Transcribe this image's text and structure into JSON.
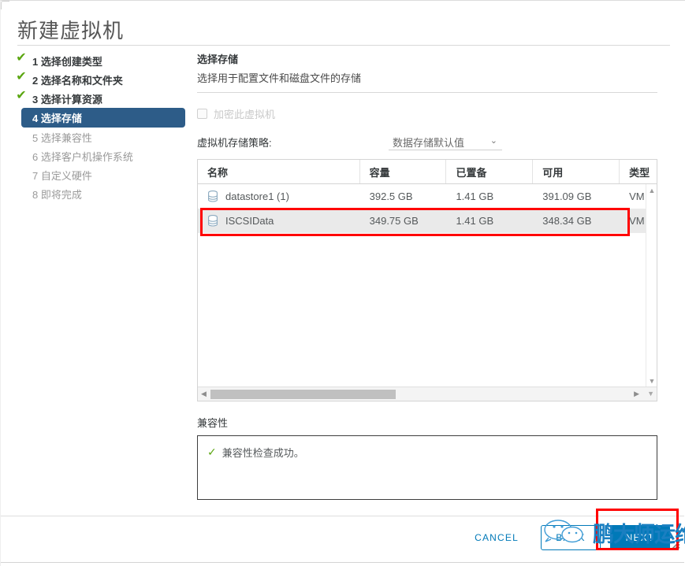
{
  "window": {
    "title": "新建虚拟机"
  },
  "steps": {
    "items": [
      {
        "num": "1",
        "label": "1 选择创建类型",
        "state": "done",
        "check": "✔"
      },
      {
        "num": "2",
        "label": "2 选择名称和文件夹",
        "state": "done",
        "check": "✔"
      },
      {
        "num": "3",
        "label": "3 选择计算资源",
        "state": "done",
        "check": "✔"
      },
      {
        "num": "4",
        "label": "4 选择存储",
        "state": "active",
        "check": ""
      },
      {
        "num": "5",
        "label": "5 选择兼容性",
        "state": "pending",
        "check": ""
      },
      {
        "num": "6",
        "label": "6 选择客户机操作系统",
        "state": "pending",
        "check": ""
      },
      {
        "num": "7",
        "label": "7 自定义硬件",
        "state": "pending",
        "check": ""
      },
      {
        "num": "8",
        "label": "8 即将完成",
        "state": "pending",
        "check": ""
      }
    ]
  },
  "content": {
    "section_title": "选择存储",
    "section_subtitle": "选择用于配置文件和磁盘文件的存储",
    "encrypt": {
      "label": "加密此虚拟机",
      "checked": false,
      "disabled": true
    },
    "policy": {
      "label": "虚拟机存储策略:",
      "value": "数据存储默认值",
      "caret": "⌄"
    },
    "table": {
      "columns": [
        "名称",
        "容量",
        "已置备",
        "可用",
        "类型"
      ],
      "rows": [
        {
          "name": "datastore1 (1)",
          "capacity": "392.5 GB",
          "provisioned": "1.41 GB",
          "free": "391.09 GB",
          "type": "VM",
          "selected": false,
          "icon": "datastore-icon"
        },
        {
          "name": "ISCSIData",
          "capacity": "349.75 GB",
          "provisioned": "1.41 GB",
          "free": "348.34 GB",
          "type": "VM",
          "selected": true,
          "icon": "datastore-icon"
        }
      ],
      "scroll_up_arrow": "▲",
      "scroll_down_arrow": "▼",
      "scroll_left_arrow": "◀",
      "scroll_right_arrow": "▶",
      "scroll_corner_arrow": "▼"
    },
    "compatibility": {
      "label": "兼容性",
      "check": "✓",
      "message": "兼容性检查成功。"
    }
  },
  "footer": {
    "cancel_label": "CANCEL",
    "back_label": "BACK",
    "next_label": "NEXT"
  },
  "watermark": {
    "text": "鹏大师运维"
  },
  "colors": {
    "accent_blue": "#0079b8",
    "step_active_bg": "#2d5c88",
    "check_green": "#5ba611",
    "annotation_red": "#ff0000",
    "selected_row_bg": "#eaeaea"
  }
}
